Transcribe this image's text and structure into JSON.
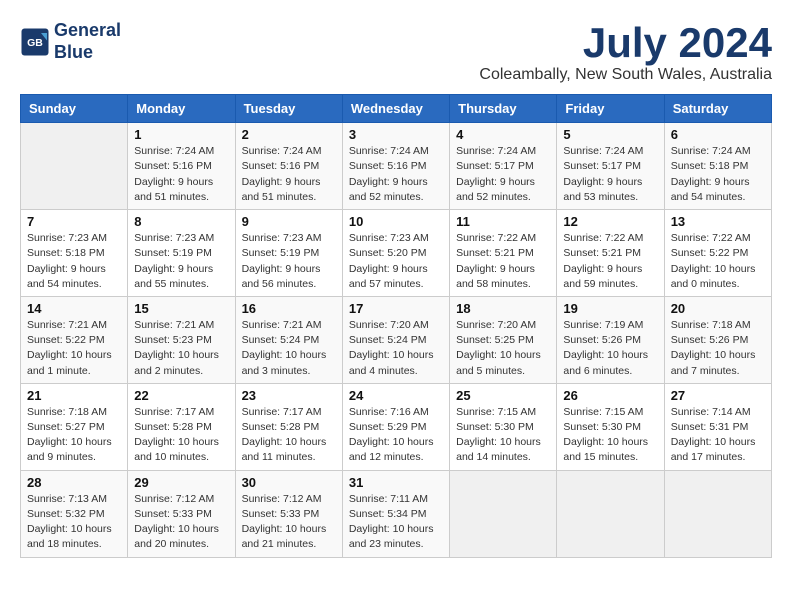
{
  "logo": {
    "line1": "General",
    "line2": "Blue"
  },
  "title": "July 2024",
  "location": "Coleambally, New South Wales, Australia",
  "headers": [
    "Sunday",
    "Monday",
    "Tuesday",
    "Wednesday",
    "Thursday",
    "Friday",
    "Saturday"
  ],
  "weeks": [
    [
      {
        "day": "",
        "info": ""
      },
      {
        "day": "1",
        "info": "Sunrise: 7:24 AM\nSunset: 5:16 PM\nDaylight: 9 hours\nand 51 minutes."
      },
      {
        "day": "2",
        "info": "Sunrise: 7:24 AM\nSunset: 5:16 PM\nDaylight: 9 hours\nand 51 minutes."
      },
      {
        "day": "3",
        "info": "Sunrise: 7:24 AM\nSunset: 5:16 PM\nDaylight: 9 hours\nand 52 minutes."
      },
      {
        "day": "4",
        "info": "Sunrise: 7:24 AM\nSunset: 5:17 PM\nDaylight: 9 hours\nand 52 minutes."
      },
      {
        "day": "5",
        "info": "Sunrise: 7:24 AM\nSunset: 5:17 PM\nDaylight: 9 hours\nand 53 minutes."
      },
      {
        "day": "6",
        "info": "Sunrise: 7:24 AM\nSunset: 5:18 PM\nDaylight: 9 hours\nand 54 minutes."
      }
    ],
    [
      {
        "day": "7",
        "info": "Sunrise: 7:23 AM\nSunset: 5:18 PM\nDaylight: 9 hours\nand 54 minutes."
      },
      {
        "day": "8",
        "info": "Sunrise: 7:23 AM\nSunset: 5:19 PM\nDaylight: 9 hours\nand 55 minutes."
      },
      {
        "day": "9",
        "info": "Sunrise: 7:23 AM\nSunset: 5:19 PM\nDaylight: 9 hours\nand 56 minutes."
      },
      {
        "day": "10",
        "info": "Sunrise: 7:23 AM\nSunset: 5:20 PM\nDaylight: 9 hours\nand 57 minutes."
      },
      {
        "day": "11",
        "info": "Sunrise: 7:22 AM\nSunset: 5:21 PM\nDaylight: 9 hours\nand 58 minutes."
      },
      {
        "day": "12",
        "info": "Sunrise: 7:22 AM\nSunset: 5:21 PM\nDaylight: 9 hours\nand 59 minutes."
      },
      {
        "day": "13",
        "info": "Sunrise: 7:22 AM\nSunset: 5:22 PM\nDaylight: 10 hours\nand 0 minutes."
      }
    ],
    [
      {
        "day": "14",
        "info": "Sunrise: 7:21 AM\nSunset: 5:22 PM\nDaylight: 10 hours\nand 1 minute."
      },
      {
        "day": "15",
        "info": "Sunrise: 7:21 AM\nSunset: 5:23 PM\nDaylight: 10 hours\nand 2 minutes."
      },
      {
        "day": "16",
        "info": "Sunrise: 7:21 AM\nSunset: 5:24 PM\nDaylight: 10 hours\nand 3 minutes."
      },
      {
        "day": "17",
        "info": "Sunrise: 7:20 AM\nSunset: 5:24 PM\nDaylight: 10 hours\nand 4 minutes."
      },
      {
        "day": "18",
        "info": "Sunrise: 7:20 AM\nSunset: 5:25 PM\nDaylight: 10 hours\nand 5 minutes."
      },
      {
        "day": "19",
        "info": "Sunrise: 7:19 AM\nSunset: 5:26 PM\nDaylight: 10 hours\nand 6 minutes."
      },
      {
        "day": "20",
        "info": "Sunrise: 7:18 AM\nSunset: 5:26 PM\nDaylight: 10 hours\nand 7 minutes."
      }
    ],
    [
      {
        "day": "21",
        "info": "Sunrise: 7:18 AM\nSunset: 5:27 PM\nDaylight: 10 hours\nand 9 minutes."
      },
      {
        "day": "22",
        "info": "Sunrise: 7:17 AM\nSunset: 5:28 PM\nDaylight: 10 hours\nand 10 minutes."
      },
      {
        "day": "23",
        "info": "Sunrise: 7:17 AM\nSunset: 5:28 PM\nDaylight: 10 hours\nand 11 minutes."
      },
      {
        "day": "24",
        "info": "Sunrise: 7:16 AM\nSunset: 5:29 PM\nDaylight: 10 hours\nand 12 minutes."
      },
      {
        "day": "25",
        "info": "Sunrise: 7:15 AM\nSunset: 5:30 PM\nDaylight: 10 hours\nand 14 minutes."
      },
      {
        "day": "26",
        "info": "Sunrise: 7:15 AM\nSunset: 5:30 PM\nDaylight: 10 hours\nand 15 minutes."
      },
      {
        "day": "27",
        "info": "Sunrise: 7:14 AM\nSunset: 5:31 PM\nDaylight: 10 hours\nand 17 minutes."
      }
    ],
    [
      {
        "day": "28",
        "info": "Sunrise: 7:13 AM\nSunset: 5:32 PM\nDaylight: 10 hours\nand 18 minutes."
      },
      {
        "day": "29",
        "info": "Sunrise: 7:12 AM\nSunset: 5:33 PM\nDaylight: 10 hours\nand 20 minutes."
      },
      {
        "day": "30",
        "info": "Sunrise: 7:12 AM\nSunset: 5:33 PM\nDaylight: 10 hours\nand 21 minutes."
      },
      {
        "day": "31",
        "info": "Sunrise: 7:11 AM\nSunset: 5:34 PM\nDaylight: 10 hours\nand 23 minutes."
      },
      {
        "day": "",
        "info": ""
      },
      {
        "day": "",
        "info": ""
      },
      {
        "day": "",
        "info": ""
      }
    ]
  ]
}
